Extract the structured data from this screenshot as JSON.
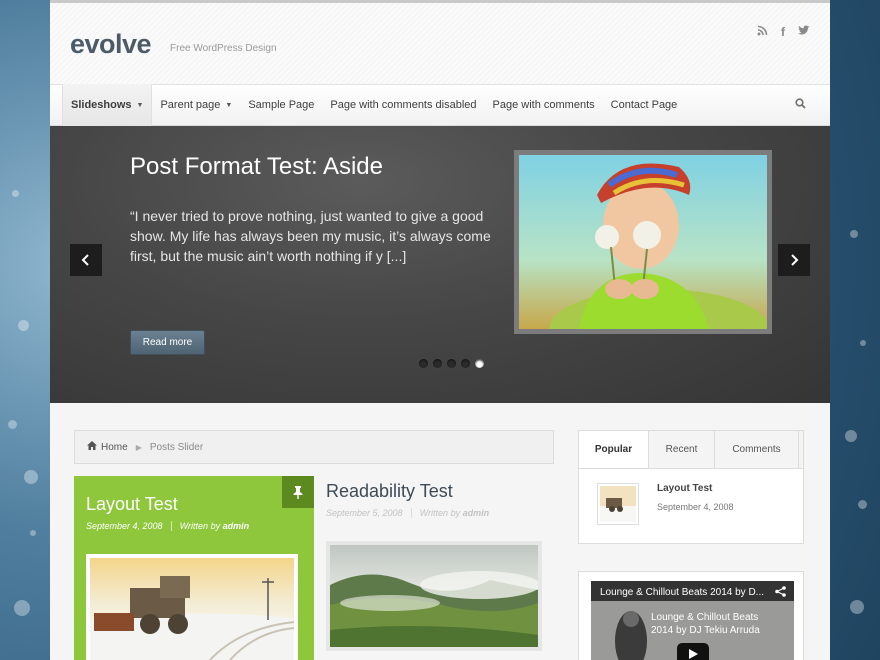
{
  "site": {
    "logo": "evolve",
    "tagline": "Free WordPress Design",
    "social": [
      "rss-icon",
      "facebook-icon",
      "twitter-icon"
    ]
  },
  "nav": {
    "items": [
      {
        "label": "Slideshows",
        "dropdown": true,
        "active": true
      },
      {
        "label": "Parent page",
        "dropdown": true,
        "active": false
      },
      {
        "label": "Sample Page",
        "dropdown": false,
        "active": false
      },
      {
        "label": "Page with comments disabled",
        "dropdown": false,
        "active": false
      },
      {
        "label": "Page with comments",
        "dropdown": false,
        "active": false
      },
      {
        "label": "Contact Page",
        "dropdown": false,
        "active": false
      }
    ]
  },
  "slider": {
    "title": "Post Format Test: Aside",
    "excerpt": "“I never tried to prove nothing, just wanted to give a good show. My life has always been my music, it’s always come first, but the music ain’t worth nothing if y [...]",
    "read_more": "Read more",
    "dots_count": 5,
    "active_dot": 5
  },
  "breadcrumb": {
    "home": "Home",
    "current": "Posts Slider"
  },
  "posts": [
    {
      "title": "Layout Test",
      "date": "September 4, 2008",
      "by": "Written by",
      "author": "admin",
      "sticky": true
    },
    {
      "title": "Readability Test",
      "date": "September 5, 2008",
      "by": "Written by",
      "author": "admin",
      "sticky": false
    }
  ],
  "tabs_widget": {
    "tabs": [
      "Popular",
      "Recent",
      "Comments"
    ],
    "active_tab": "Popular",
    "post_title": "Layout Test",
    "post_date": "September 4, 2008"
  },
  "video_widget": {
    "title": "Lounge & Chillout Beats 2014 by D...",
    "caption_line1": "Lounge & Chillout Beats",
    "caption_line2": "2014 by DJ Tekiu Arruda"
  },
  "colors": {
    "accent_green": "#8ec73b",
    "logo": "#4d5b69",
    "slider_bg": "#464646"
  }
}
